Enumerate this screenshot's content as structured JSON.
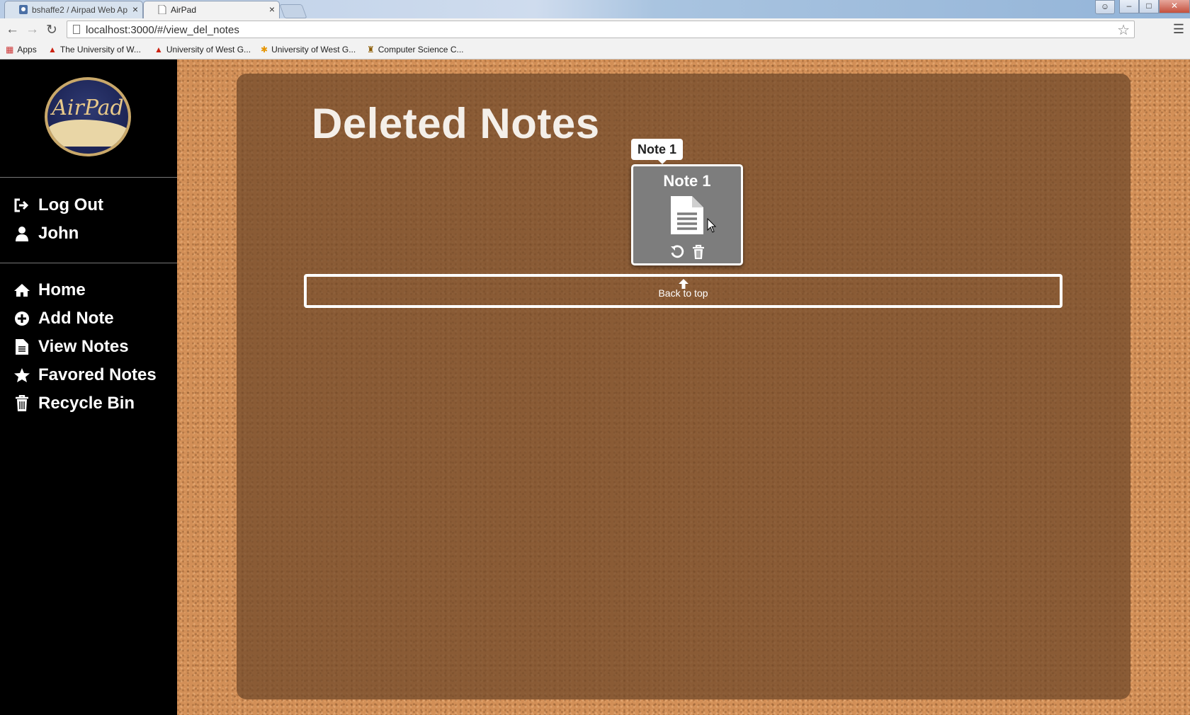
{
  "browser": {
    "tabs": [
      {
        "title": "bshaffe2 / Airpad Web Ap",
        "active": false
      },
      {
        "title": "AirPad",
        "active": true
      }
    ],
    "url": "localhost:3000/#/view_del_notes",
    "bookmarks": [
      {
        "label": "Apps",
        "icon": "apps-grid-icon"
      },
      {
        "label": "The University of W...",
        "icon": "wolf-icon"
      },
      {
        "label": "University of West G...",
        "icon": "wolf-icon"
      },
      {
        "label": "University of West G...",
        "icon": "asterisk-icon"
      },
      {
        "label": "Computer Science C...",
        "icon": "grad-cap-icon"
      }
    ]
  },
  "sidebar": {
    "logo_text": "AirPad",
    "user_items": [
      {
        "label": "Log Out",
        "icon": "sign-out-icon"
      },
      {
        "label": "John",
        "icon": "user-icon"
      }
    ],
    "nav_items": [
      {
        "label": "Home",
        "icon": "home-icon"
      },
      {
        "label": "Add Note",
        "icon": "plus-circle-icon"
      },
      {
        "label": "View Notes",
        "icon": "document-icon"
      },
      {
        "label": "Favored Notes",
        "icon": "star-icon"
      },
      {
        "label": "Recycle Bin",
        "icon": "trash-icon"
      }
    ]
  },
  "main": {
    "title": "Deleted Notes",
    "tooltip": "Note 1",
    "notes": [
      {
        "title": "Note 1",
        "actions": [
          "restore-icon",
          "delete-icon"
        ]
      }
    ],
    "back_to_top": "Back to top"
  },
  "colors": {
    "sidebar_bg": "#000000",
    "cork": "#d28f57",
    "note_bg": "#7d7d7d",
    "text_light": "#ffffff"
  }
}
